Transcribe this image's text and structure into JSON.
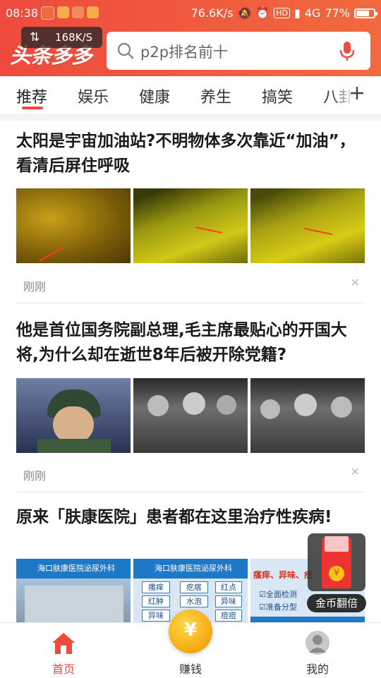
{
  "status_bar": {
    "time": "08:38",
    "net_speed": "76.6K/s",
    "hd": "HD",
    "network": "4G",
    "battery": "77%",
    "battery_level": 0.77
  },
  "header": {
    "logo": "头条多多",
    "speed_overlay": "168K/S",
    "search_placeholder": "p2p排名前十",
    "accent_color": "#ef4a3d"
  },
  "tabs": [
    "推荐",
    "娱乐",
    "健康",
    "养生",
    "搞笑",
    "八卦"
  ],
  "articles": [
    {
      "title": "太阳是宇宙加油站?不明物体多次靠近“加油”，看清后屏住呼吸",
      "time": "刚刚"
    },
    {
      "title": "他是首位国务院副总理,毛主席最贴心的开国大将,为什么却在逝世8年后被开除党籍?",
      "time": "刚刚"
    },
    {
      "title": "原来「肤康医院」患者都在这里治疗性疾病!",
      "ad_images": {
        "banner": "海口肤康医院泌尿外科",
        "cells": [
          "瘙痒",
          "疙瘩",
          "红点",
          "红肿",
          "水泡",
          "异味",
          "异味",
          "痘痘"
        ],
        "headline": "瘙痒、异味、疙",
        "checks": [
          "全面检测",
          "准备分型"
        ]
      }
    }
  ],
  "float_bonus": {
    "label": "金币翻倍",
    "coin": "¥"
  },
  "bottom_nav": {
    "home": "首页",
    "earn": "赚钱",
    "earn_coin": "¥",
    "mine": "我的",
    "active_color": "#ef4a3d"
  }
}
